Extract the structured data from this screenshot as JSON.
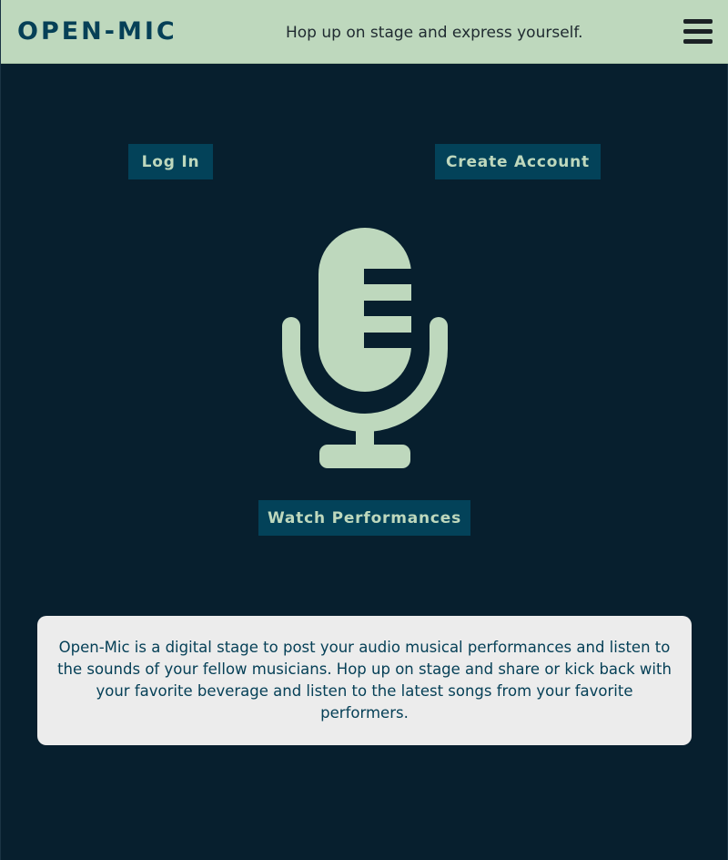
{
  "header": {
    "brand": "OPEN-MIC",
    "tagline": "Hop up on stage and express yourself."
  },
  "actions": {
    "login_label": "Log In",
    "create_account_label": "Create Account",
    "watch_label": "Watch Performances"
  },
  "hero": {
    "icon": "microphone-icon"
  },
  "about": {
    "text": "Open-Mic is a digital stage to post your audio musical performances and listen to the sounds of your fellow musicians. Hop up on stage and share or kick back with your favorite beverage and listen to the latest songs from your favorite performers."
  },
  "colors": {
    "header_bg": "#bed8bd",
    "page_bg": "#071f2e",
    "button_bg": "#034259",
    "accent": "#bed8bd",
    "brand_text": "#064057",
    "card_bg": "#ececec"
  }
}
